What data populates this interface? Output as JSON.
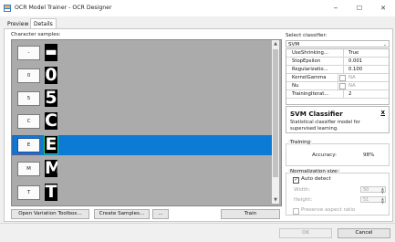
{
  "window": {
    "title": "OCR Model Trainer - OCR Designer",
    "minimize_glyph": "–",
    "maximize_glyph": "☐",
    "close_glyph": "✕"
  },
  "tabs": [
    {
      "label": "Preview",
      "active": false
    },
    {
      "label": "Details",
      "active": true
    }
  ],
  "samples": {
    "label": "Character samples:",
    "items": [
      {
        "label": "-",
        "glyph": "▬",
        "selected": false
      },
      {
        "label": "0",
        "glyph": "0",
        "selected": false
      },
      {
        "label": "5",
        "glyph": "5",
        "selected": false
      },
      {
        "label": "C",
        "glyph": "C",
        "selected": false
      },
      {
        "label": "E",
        "glyph": "E",
        "selected": true
      },
      {
        "label": "M",
        "glyph": "M",
        "selected": false
      },
      {
        "label": "T",
        "glyph": "T",
        "selected": false
      }
    ]
  },
  "buttons": {
    "open_variation": "Open Variation Toolbox...",
    "create_samples": "Create Samples...",
    "more": "...",
    "train": "Train",
    "ok": "OK",
    "cancel": "Cancel"
  },
  "classifier": {
    "label": "Select classifier:",
    "selected": "SVM",
    "properties": [
      {
        "name": "UseShrinking...",
        "value": "True",
        "muted": false,
        "checkbox": false
      },
      {
        "name": "StopEpsilon",
        "value": "0.001",
        "muted": false,
        "checkbox": false
      },
      {
        "name": "Regularizatio...",
        "value": "0.100",
        "muted": false,
        "checkbox": false
      },
      {
        "name": "KernelGamma",
        "value": "NA",
        "muted": true,
        "checkbox": true
      },
      {
        "name": "Nu",
        "value": "NA",
        "muted": true,
        "checkbox": true
      },
      {
        "name": "TrainingIterat...",
        "value": "2",
        "muted": false,
        "checkbox": false
      }
    ],
    "description_title": "SVM Classifier",
    "description_text": "Statistical classifier model for supervised learning.",
    "description_close": "x"
  },
  "training": {
    "group_label": "Training",
    "accuracy_label": "Accuracy:",
    "accuracy_value": "98%"
  },
  "normalization": {
    "group_label": "Normalization size:",
    "auto_detect_label": "Auto detect",
    "auto_detect_checked": true,
    "width_label": "Width:",
    "width_value": "50",
    "height_label": "Height:",
    "height_value": "51",
    "preserve_label": "Preserve aspect ratio"
  }
}
